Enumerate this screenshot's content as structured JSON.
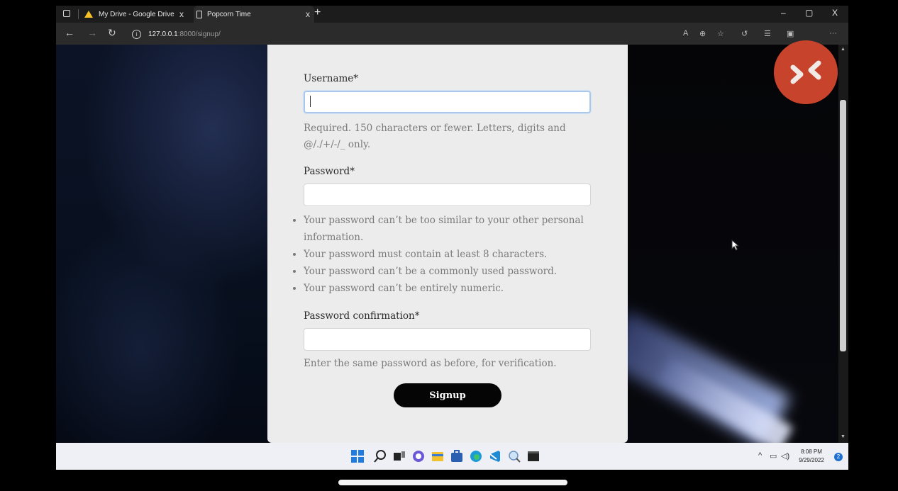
{
  "browser": {
    "tabs": [
      {
        "label": "My Drive - Google Drive",
        "icon": "google-drive-icon",
        "active": false
      },
      {
        "label": "Popcorn Time",
        "icon": "document-icon",
        "active": true
      }
    ],
    "new_tab_symbol": "+",
    "tab_close_symbol": "x",
    "window_controls": {
      "minimize": "–",
      "restore": "▢",
      "close": "X"
    },
    "url_host": "127.0.0.1",
    "url_path": ":8000/signup/",
    "menu_symbol": "···"
  },
  "form": {
    "username": {
      "label": "Username*",
      "value": "",
      "help": "Required. 150 characters or fewer. Letters, digits and @/./+/-/_ only."
    },
    "password": {
      "label": "Password*",
      "value": "",
      "rules": [
        "Your password can’t be too similar to your other personal information.",
        "Your password must contain at least 8 characters.",
        "Your password can’t be a commonly used password.",
        "Your password can’t be entirely numeric."
      ]
    },
    "password_confirmation": {
      "label": "Password confirmation*",
      "value": "",
      "help": "Enter the same password as before, for verification."
    },
    "submit_label": "Signup"
  },
  "taskbar": {
    "apps": [
      "windows-start-icon",
      "search-icon",
      "task-view-icon",
      "chat-icon",
      "file-explorer-icon",
      "store-icon",
      "edge-icon",
      "vscode-icon",
      "magnifier-icon",
      "terminal-icon"
    ],
    "clock_time": "8:08 PM",
    "clock_date": "9/29/2022",
    "notification_count": "2"
  },
  "colors": {
    "card_bg": "#ececec",
    "button_bg": "#050505",
    "badge": "#c8432b",
    "focus_border": "#a9c8ec"
  }
}
